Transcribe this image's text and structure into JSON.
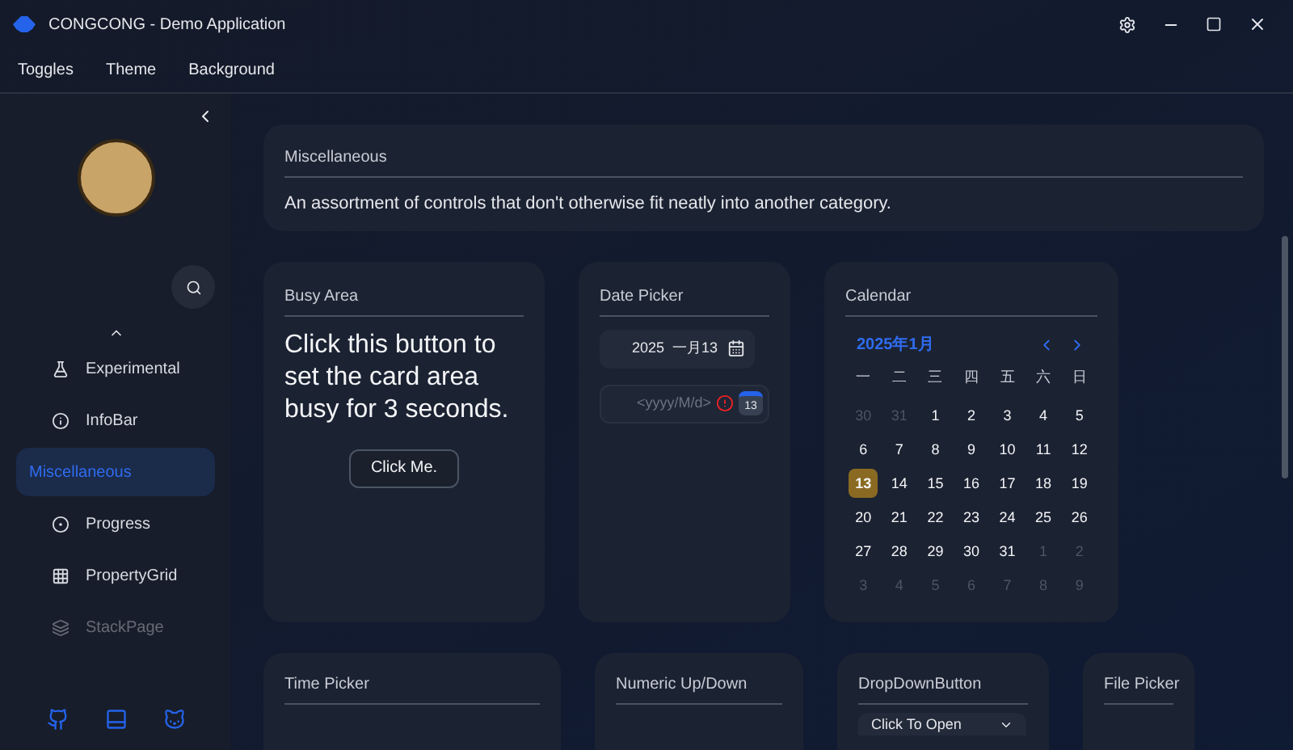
{
  "window": {
    "title": "CONGCONG - Demo Application"
  },
  "menu": [
    {
      "label": "Toggles"
    },
    {
      "label": "Theme"
    },
    {
      "label": "Background"
    }
  ],
  "sidebar": {
    "items": [
      {
        "label": "Experimental",
        "selected": false,
        "faded": false
      },
      {
        "label": "InfoBar",
        "selected": false,
        "faded": false
      },
      {
        "label": "Miscellaneous",
        "selected": true,
        "faded": false
      },
      {
        "label": "Progress",
        "selected": false,
        "faded": false
      },
      {
        "label": "PropertyGrid",
        "selected": false,
        "faded": false
      },
      {
        "label": "StackPage",
        "selected": false,
        "faded": true
      }
    ]
  },
  "header_card": {
    "title": "Miscellaneous",
    "description": "An assortment of controls that don't otherwise fit neatly into another category."
  },
  "busy_card": {
    "title": "Busy Area",
    "text": "Click this button to set the card area busy for 3 seconds.",
    "button": "Click Me."
  },
  "date_card": {
    "title": "Date Picker",
    "value": "2025  一月13",
    "placeholder": "<yyyy/M/d>",
    "icon_day": "13",
    "error": true
  },
  "calendar": {
    "title": "Calendar",
    "month": "2025年1月",
    "weekdays": [
      "一",
      "二",
      "三",
      "四",
      "五",
      "六",
      "日"
    ],
    "days": [
      {
        "label": "30",
        "current": false,
        "selected": false
      },
      {
        "label": "31",
        "current": false,
        "selected": false
      },
      {
        "label": "1",
        "current": true,
        "selected": false
      },
      {
        "label": "2",
        "current": true,
        "selected": false
      },
      {
        "label": "3",
        "current": true,
        "selected": false
      },
      {
        "label": "4",
        "current": true,
        "selected": false
      },
      {
        "label": "5",
        "current": true,
        "selected": false
      },
      {
        "label": "6",
        "current": true,
        "selected": false
      },
      {
        "label": "7",
        "current": true,
        "selected": false
      },
      {
        "label": "8",
        "current": true,
        "selected": false
      },
      {
        "label": "9",
        "current": true,
        "selected": false
      },
      {
        "label": "10",
        "current": true,
        "selected": false
      },
      {
        "label": "11",
        "current": true,
        "selected": false
      },
      {
        "label": "12",
        "current": true,
        "selected": false
      },
      {
        "label": "13",
        "current": true,
        "selected": true
      },
      {
        "label": "14",
        "current": true,
        "selected": false
      },
      {
        "label": "15",
        "current": true,
        "selected": false
      },
      {
        "label": "16",
        "current": true,
        "selected": false
      },
      {
        "label": "17",
        "current": true,
        "selected": false
      },
      {
        "label": "18",
        "current": true,
        "selected": false
      },
      {
        "label": "19",
        "current": true,
        "selected": false
      },
      {
        "label": "20",
        "current": true,
        "selected": false
      },
      {
        "label": "21",
        "current": true,
        "selected": false
      },
      {
        "label": "22",
        "current": true,
        "selected": false
      },
      {
        "label": "23",
        "current": true,
        "selected": false
      },
      {
        "label": "24",
        "current": true,
        "selected": false
      },
      {
        "label": "25",
        "current": true,
        "selected": false
      },
      {
        "label": "26",
        "current": true,
        "selected": false
      },
      {
        "label": "27",
        "current": true,
        "selected": false
      },
      {
        "label": "28",
        "current": true,
        "selected": false
      },
      {
        "label": "29",
        "current": true,
        "selected": false
      },
      {
        "label": "30",
        "current": true,
        "selected": false
      },
      {
        "label": "31",
        "current": true,
        "selected": false
      },
      {
        "label": "1",
        "current": false,
        "selected": false
      },
      {
        "label": "2",
        "current": false,
        "selected": false
      },
      {
        "label": "3",
        "current": false,
        "selected": false
      },
      {
        "label": "4",
        "current": false,
        "selected": false
      },
      {
        "label": "5",
        "current": false,
        "selected": false
      },
      {
        "label": "6",
        "current": false,
        "selected": false
      },
      {
        "label": "7",
        "current": false,
        "selected": false
      },
      {
        "label": "8",
        "current": false,
        "selected": false
      },
      {
        "label": "9",
        "current": false,
        "selected": false
      }
    ]
  },
  "bottom_cards": [
    {
      "title": "Time Picker"
    },
    {
      "title": "Numeric Up/Down"
    },
    {
      "title": "DropDownButton",
      "button": "Click To Open"
    },
    {
      "title": "File Picker"
    }
  ]
}
